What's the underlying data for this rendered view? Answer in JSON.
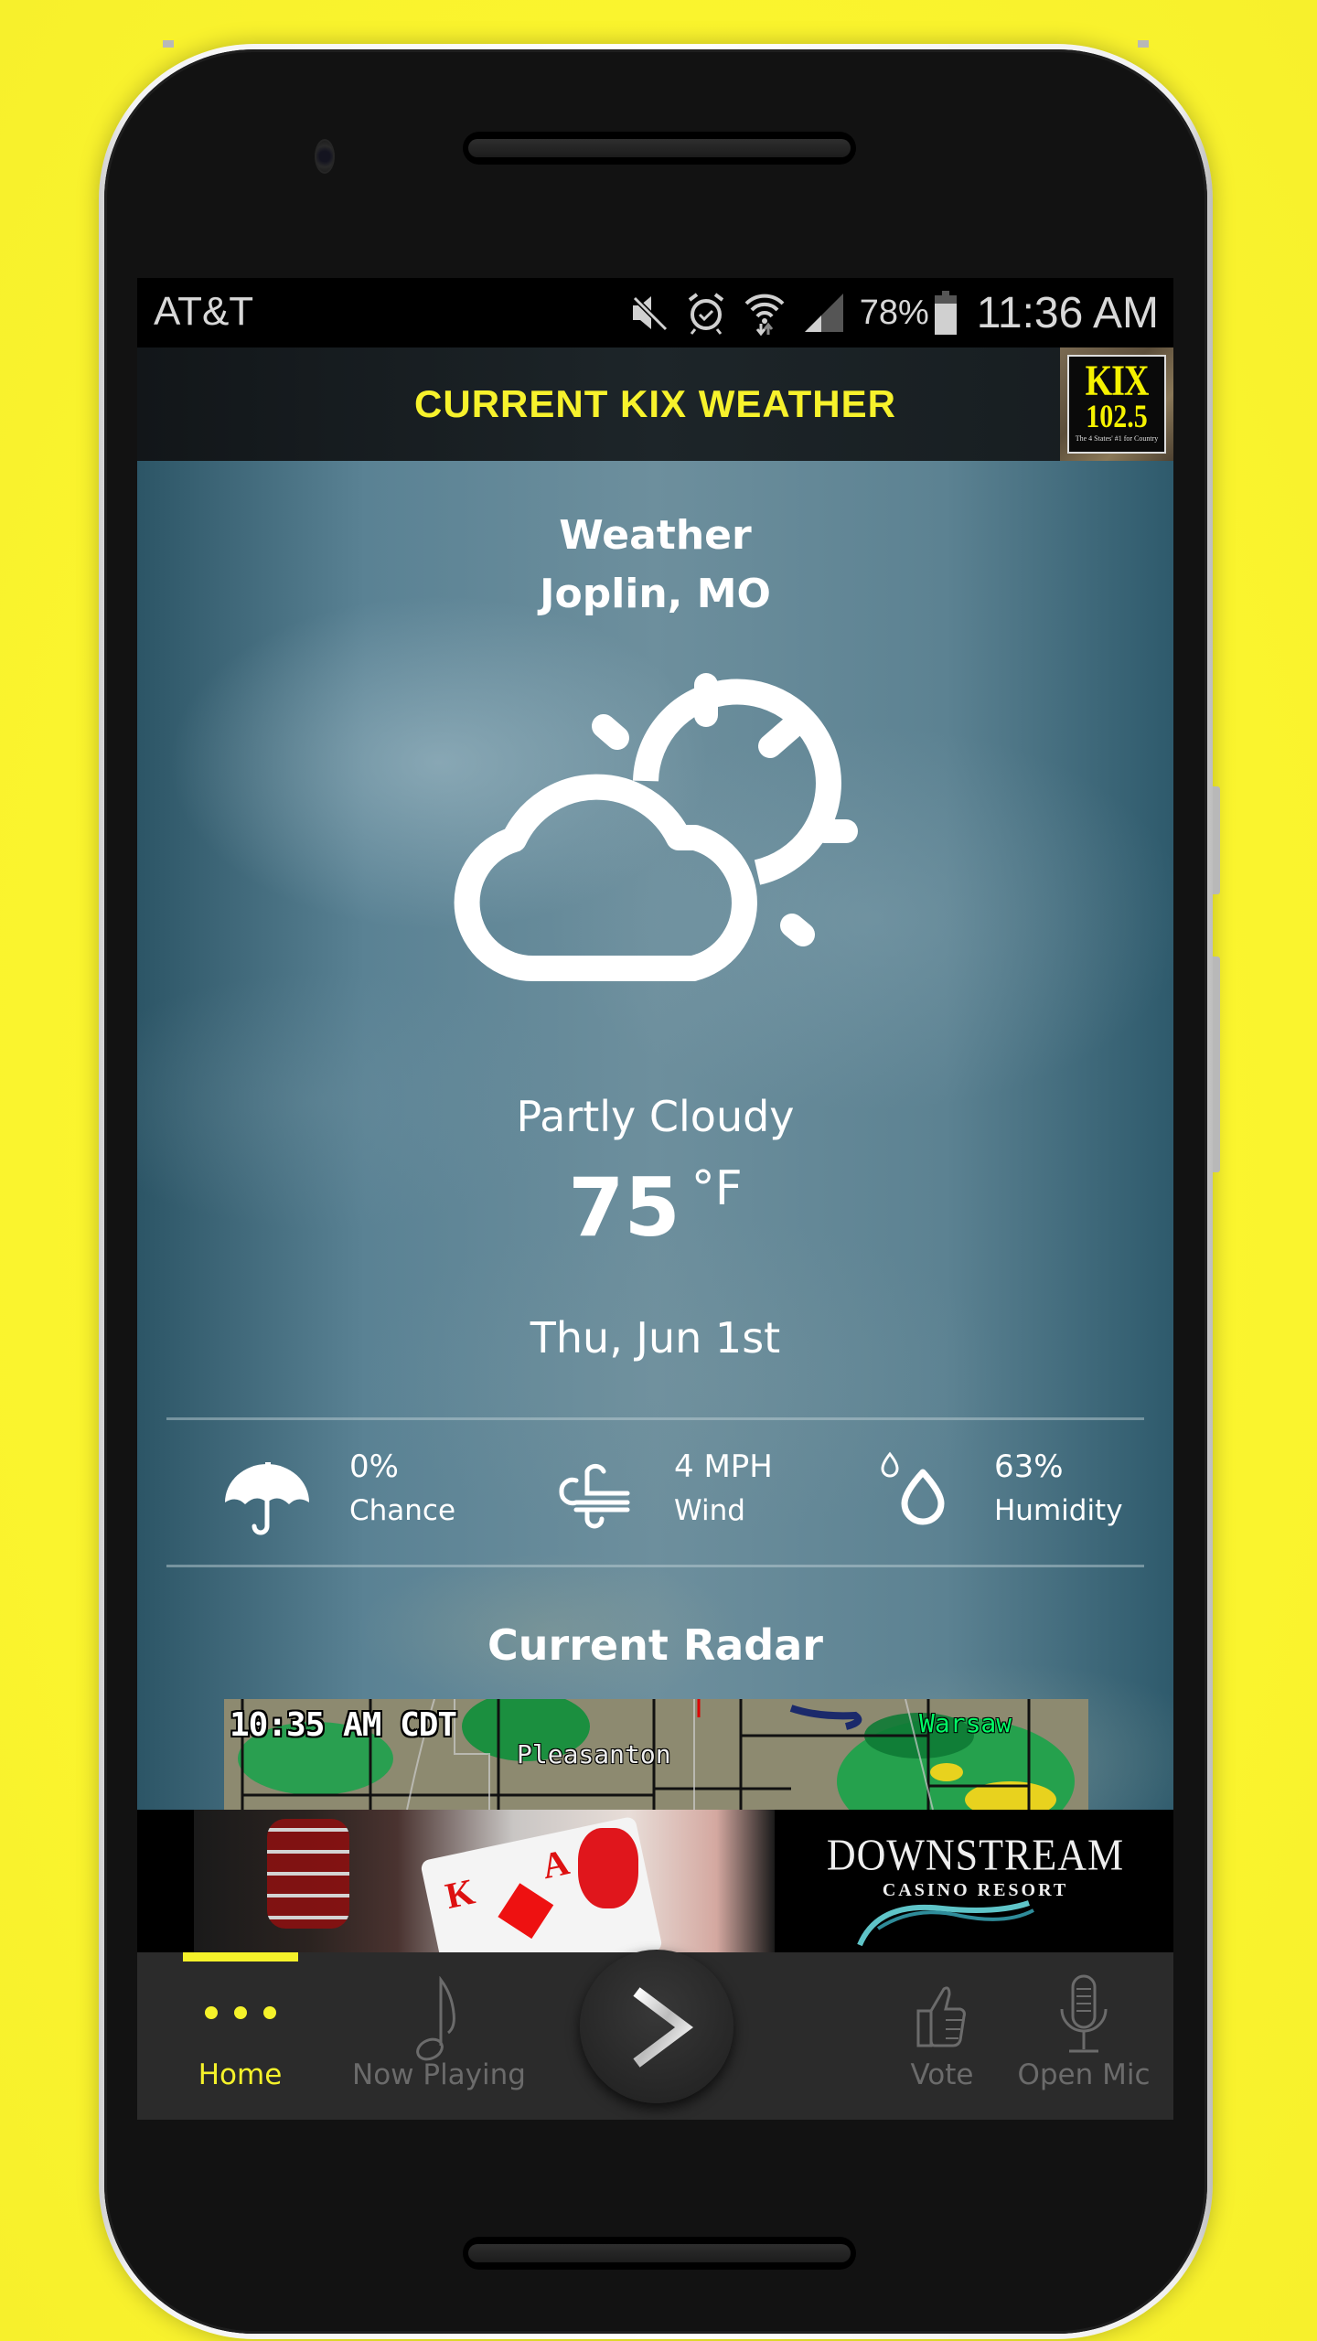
{
  "status_bar": {
    "carrier": "AT&T",
    "icons": [
      "mute-icon",
      "alarm-icon",
      "wifi-icon",
      "signal-icon",
      "battery-icon"
    ],
    "battery_percent": "78%",
    "battery_level": 0.78,
    "time": "11:36 AM"
  },
  "header": {
    "title": "CURRENT KIX WEATHER",
    "logo": {
      "name": "KIX",
      "frequency": "102.5",
      "tagline": "The 4 States' #1 for Country"
    }
  },
  "weather": {
    "heading": "Weather",
    "location": "Joplin, MO",
    "icon": "partly-cloudy-icon",
    "condition": "Partly Cloudy",
    "temperature": "75",
    "unit": "°F",
    "date": "Thu, Jun 1st",
    "stats": [
      {
        "icon": "umbrella-icon",
        "value": "0%",
        "label": "Chance"
      },
      {
        "icon": "wind-icon",
        "value": "4 MPH",
        "label": "Wind"
      },
      {
        "icon": "humidity-icon",
        "value": "63%",
        "label": "Humidity"
      }
    ],
    "radar": {
      "title": "Current Radar",
      "timestamp": "10:35 AM CDT",
      "cities": [
        "Pleasanton",
        "Warsaw"
      ]
    }
  },
  "ad": {
    "brand": "DOWNSTREAM",
    "subtitle": "CASINO RESORT"
  },
  "bottom_nav": {
    "items": [
      {
        "label": "Home",
        "icon": "more-dots-icon",
        "active": true
      },
      {
        "label": "Now Playing",
        "icon": "music-note-icon",
        "active": false
      },
      {
        "label": "",
        "icon": "play-icon",
        "active": false
      },
      {
        "label": "Vote",
        "icon": "thumbs-up-icon",
        "active": false
      },
      {
        "label": "Open Mic",
        "icon": "microphone-icon",
        "active": false
      }
    ]
  },
  "colors": {
    "accent": "#f5f22a",
    "background": "#f7f22c",
    "inactive_nav": "#6b6b6b"
  }
}
